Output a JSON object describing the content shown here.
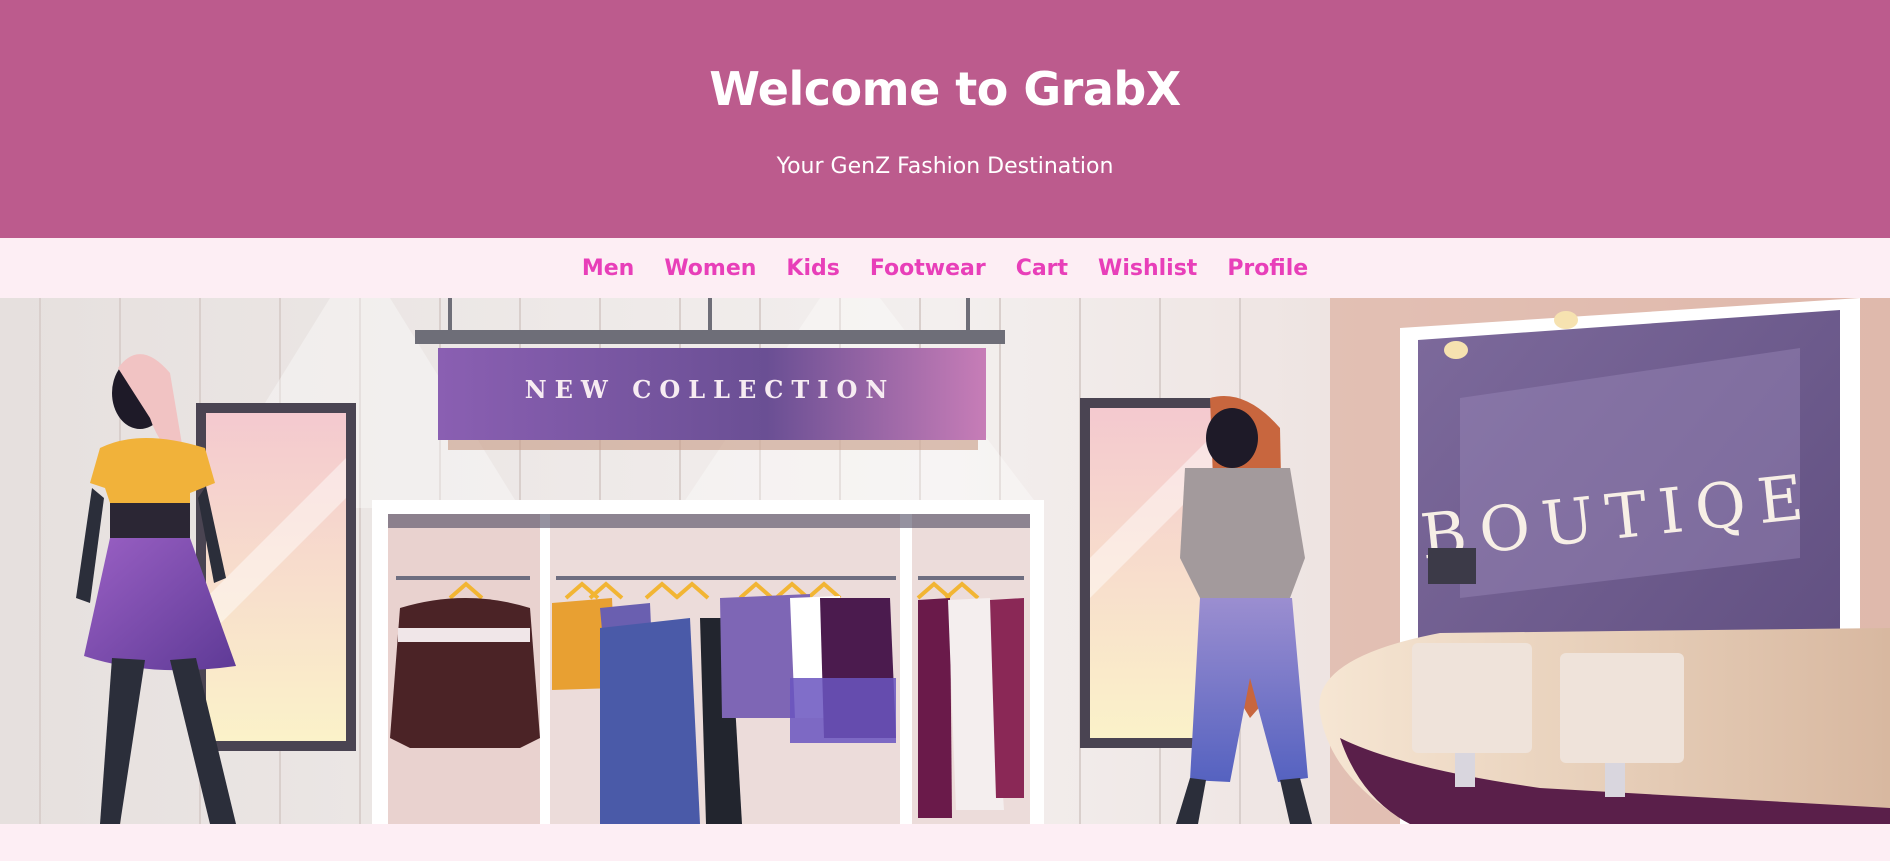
{
  "header": {
    "title": "Welcome to GrabX",
    "subtitle": "Your GenZ Fashion Destination"
  },
  "nav": {
    "items": [
      {
        "label": "Men"
      },
      {
        "label": "Women"
      },
      {
        "label": "Kids"
      },
      {
        "label": "Footwear"
      },
      {
        "label": "Cart"
      },
      {
        "label": "Wishlist"
      },
      {
        "label": "Profile"
      }
    ]
  },
  "hero": {
    "banner_text": "NEW COLLECTION",
    "shop_sign": "BOUTIQE"
  },
  "colors": {
    "header_bg": "#bc5b8d",
    "nav_bg": "#fdeef4",
    "nav_link": "#e83fb9"
  }
}
